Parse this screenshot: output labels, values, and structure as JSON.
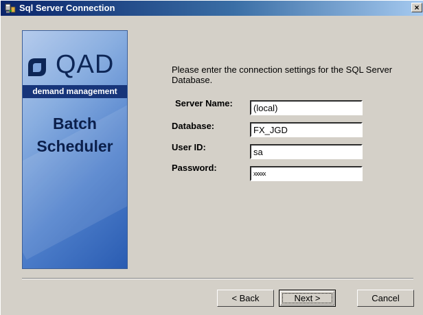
{
  "window": {
    "title": "Sql Server Connection",
    "close_label": "×"
  },
  "banner": {
    "logo_text": "QAD",
    "tagline": "demand management",
    "product_line1": "Batch",
    "product_line2": "Scheduler"
  },
  "form": {
    "intro": "Please enter the connection settings for the SQL Server Database.",
    "server_name": {
      "label": "Server Name:",
      "value": "(local)"
    },
    "database": {
      "label": "Database:",
      "value": "FX_JGD"
    },
    "user_id": {
      "label": "User ID:",
      "value": "sa"
    },
    "password": {
      "label": "Password:",
      "value": "xxxxx"
    }
  },
  "buttons": {
    "back": "< Back",
    "next": "Next >",
    "cancel": "Cancel"
  },
  "colors": {
    "title_bar": "#0a246a",
    "dialog_bg": "#d4d0c8",
    "banner_blue": "#4e7fcb",
    "tagline_bg": "#17357a"
  }
}
